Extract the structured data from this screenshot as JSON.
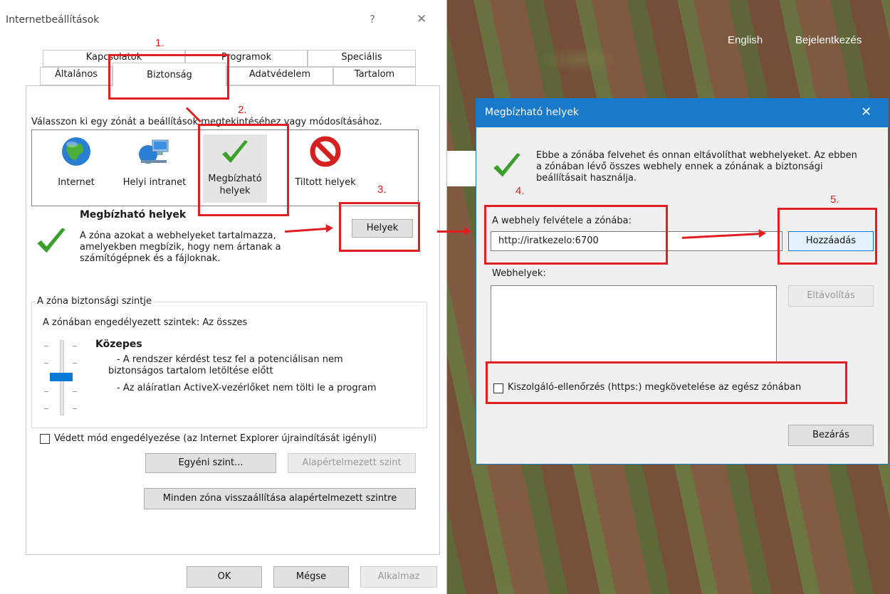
{
  "background": {
    "links": [
      "English",
      "Bejelentkezés"
    ]
  },
  "ie_dialog": {
    "title": "Internetbeállítások",
    "help": "?",
    "close": "✕",
    "tabs_row1": [
      "Kapcsolatok",
      "Programok",
      "Speciális"
    ],
    "tabs_row2": [
      "Általános",
      "Biztonság",
      "Adatvédelem",
      "Tartalom"
    ],
    "zone_prompt": "Válasszon ki egy zónát a beállítások megtekintéséhez vagy módosításához.",
    "zones": [
      {
        "label": "Internet",
        "icon": "globe-icon"
      },
      {
        "label": "Helyi intranet",
        "icon": "network-icon"
      },
      {
        "label": "Megbízható\nhelyek",
        "icon": "checkmark-icon"
      },
      {
        "label": "Tiltott helyek",
        "icon": "blocked-icon"
      }
    ],
    "zone_title": "Megbízható helyek",
    "zone_desc": "A zóna azokat a webhelyeket tartalmazza, amelyekben megbízik, hogy nem ártanak a számítógépnek és a fájloknak.",
    "sites_button": "Helyek",
    "security_group_label": "A zóna biztonsági szintje",
    "allowed_levels": "A zónában engedélyezett szintek: Az összes",
    "level_name": "Közepes",
    "level_desc1": "- A rendszer kérdést tesz fel a potenciálisan nem biztonságos tartalom letöltése előtt",
    "level_desc2": "- Az aláíratlan ActiveX-vezérlőket nem tölti le a program",
    "protected_mode": "Védett mód engedélyezése (az Internet Explorer újraindítását igényli)",
    "custom_level": "Egyéni szint...",
    "default_level": "Alapértelmezett szint",
    "reset_all": "Minden zóna visszaállítása alapértelmezett szintre",
    "ok": "OK",
    "cancel": "Mégse",
    "apply": "Alkalmaz"
  },
  "trusted_dialog": {
    "title": "Megbízható helyek",
    "close": "✕",
    "info": "Ebbe a zónába felvehet és onnan eltávolíthat webhelyeket. Az ebben a zónában lévő összes webhely ennek a zónának a biztonsági beállításait használja.",
    "add_label": "A webhely felvétele a zónába:",
    "add_value": "http://iratkezelo:6700",
    "add_button": "Hozzáadás",
    "sites_label": "Webhelyek:",
    "remove_button": "Eltávolítás",
    "https_check": "Kiszolgáló-ellenőrzés (https:) megkövetelése az egész zónában",
    "close_button": "Bezárás"
  },
  "annotations": [
    "1.",
    "2.",
    "3.",
    "4.",
    "5."
  ],
  "colors": {
    "accent": "#1979ca",
    "annotation": "#e02020",
    "check": "#3aa02a"
  }
}
